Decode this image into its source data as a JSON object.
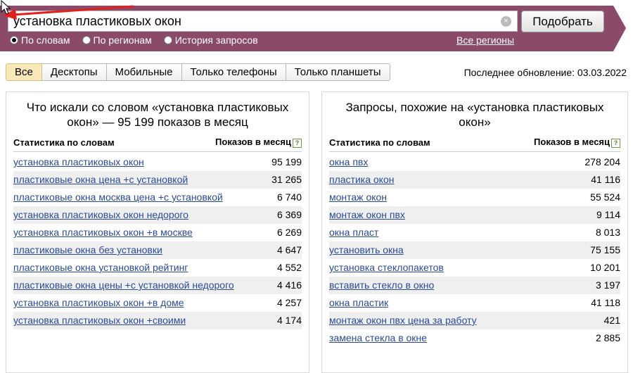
{
  "search": {
    "query": "установка пластиковых окон",
    "button_label": "Подобрать",
    "modes": [
      {
        "label": "По словам",
        "selected": true
      },
      {
        "label": "По регионам",
        "selected": false
      },
      {
        "label": "История запросов",
        "selected": false
      }
    ],
    "regions_link": "Все регионы"
  },
  "tabs": [
    "Все",
    "Десктопы",
    "Мобильные",
    "Только телефоны",
    "Только планшеты"
  ],
  "last_update": "Последнее обновление: 03.03.2022",
  "left_panel": {
    "title": "Что искали со словом «установка пластиковых окон» — 95 199 показов в месяц",
    "col_left": "Статистика по словам",
    "col_right": "Показов в месяц",
    "rows": [
      {
        "phrase": "установка пластиковых окон",
        "count": "95 199"
      },
      {
        "phrase": "пластиковые окна цена +с установкой",
        "count": "31 265"
      },
      {
        "phrase": "пластиковые окна москва цена +с установкой",
        "count": "6 740"
      },
      {
        "phrase": "установка пластиковых окон недорого",
        "count": "6 369"
      },
      {
        "phrase": "установка пластиковых окон +в москве",
        "count": "6 269"
      },
      {
        "phrase": "пластиковые окна без установки",
        "count": "4 647"
      },
      {
        "phrase": "пластиковые окна установкой рейтинг",
        "count": "4 552"
      },
      {
        "phrase": "пластиковые окна цены +с установкой недорого",
        "count": "4 416"
      },
      {
        "phrase": "установка пластиковых окон +в доме",
        "count": "4 257"
      },
      {
        "phrase": "установка пластиковых окон +своими",
        "count": "4 174"
      }
    ]
  },
  "right_panel": {
    "title": "Запросы, похожие на «установка пластиковых окон»",
    "col_left": "Статистика по словам",
    "col_right": "Показов в месяц",
    "rows": [
      {
        "phrase": "окна пвх",
        "count": "278 204"
      },
      {
        "phrase": "пластика окон",
        "count": "41 116"
      },
      {
        "phrase": "монтаж окон",
        "count": "55 524"
      },
      {
        "phrase": "монтаж окон пвх",
        "count": "9 114"
      },
      {
        "phrase": "окна пласт",
        "count": "8 013"
      },
      {
        "phrase": "установить окна",
        "count": "75 155"
      },
      {
        "phrase": "установка стеклопакетов",
        "count": "10 201"
      },
      {
        "phrase": "вставить стекло в окно",
        "count": "3 197"
      },
      {
        "phrase": "окна пластик",
        "count": "41 118"
      },
      {
        "phrase": "монтаж окон пвх цена за работу",
        "count": "421"
      },
      {
        "phrase": "замена стекла в окне",
        "count": "2 885"
      }
    ]
  },
  "colors": {
    "banner": "#8b4a6a",
    "link": "#2a4a9a",
    "arrow": "#e0201a",
    "active_tab": "#f9e9b8"
  }
}
